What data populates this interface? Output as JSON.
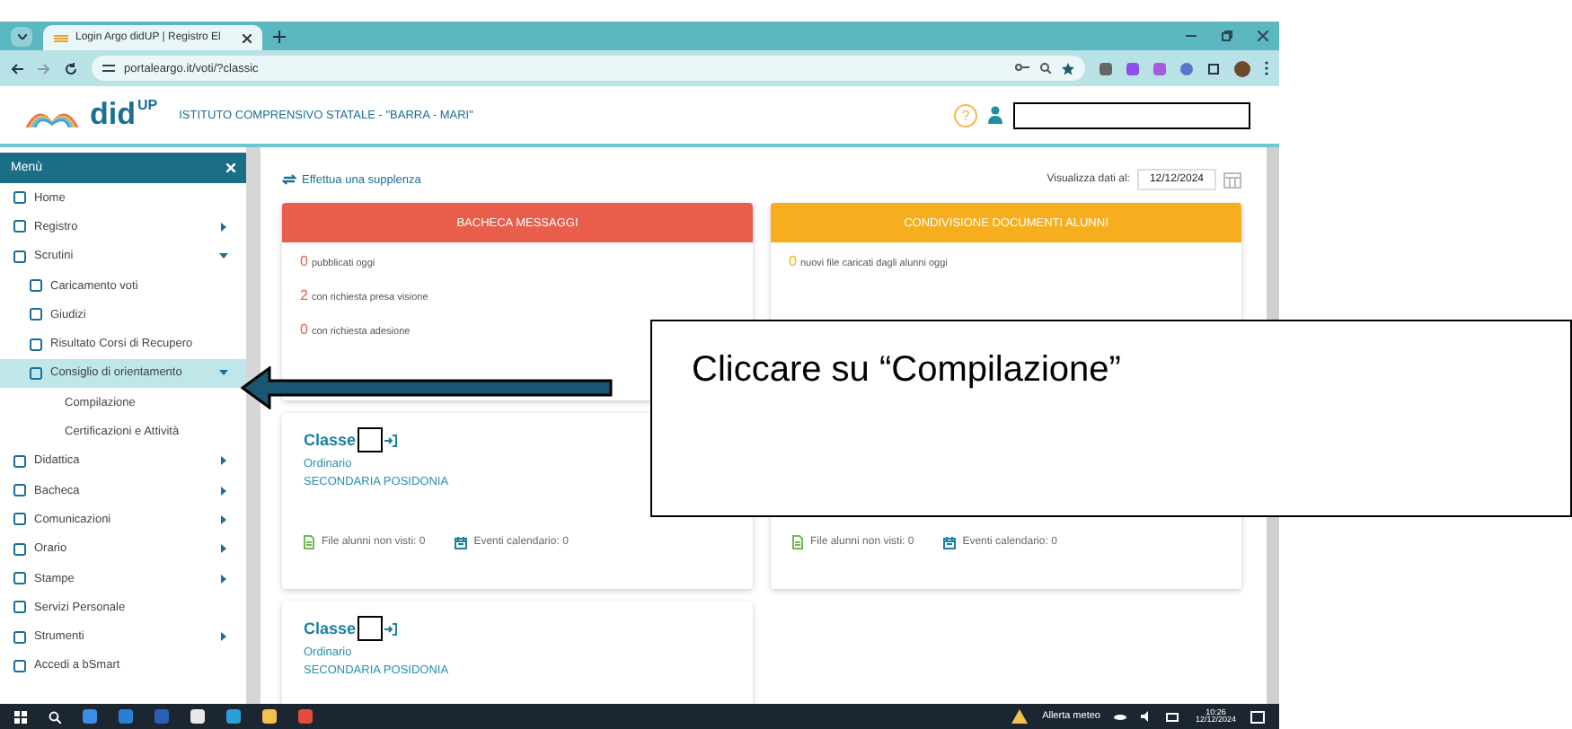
{
  "browser": {
    "tab_title": "Login Argo didUP | Registro El",
    "url": "portaleargo.it/voti/?classic"
  },
  "header": {
    "help": "?",
    "app_name": "did",
    "app_sup": "UP",
    "school": "ISTITUTO COMPRENSIVO STATALE - \"BARRA - MARI\""
  },
  "sidebar": {
    "title": "Menù",
    "items": [
      {
        "label": "Home",
        "selected": false
      },
      {
        "label": "Registro",
        "selected": false,
        "expanded": false
      },
      {
        "label": "Scrutini",
        "selected": false,
        "expanded": true,
        "children": [
          {
            "label": "Caricamento voti",
            "selected": false
          },
          {
            "label": "Giudizi",
            "selected": false
          },
          {
            "label": "Risultato Corsi di Recupero",
            "selected": false
          },
          {
            "label": "Consiglio di orientamento",
            "selected": true,
            "expanded": true,
            "children": [
              {
                "label": "Compilazione",
                "selected": false
              },
              {
                "label": "Certificazioni e Attività",
                "selected": false
              }
            ]
          }
        ]
      },
      {
        "label": "Didattica",
        "selected": false,
        "expanded": false
      },
      {
        "label": "Bacheca",
        "selected": false,
        "expanded": false
      },
      {
        "label": "Comunicazioni",
        "selected": false,
        "expanded": false
      },
      {
        "label": "Orario",
        "selected": false,
        "expanded": false
      },
      {
        "label": "Stampe",
        "selected": false,
        "expanded": false
      },
      {
        "label": "Servizi Personale",
        "selected": false
      },
      {
        "label": "Strumenti",
        "selected": false,
        "expanded": false
      },
      {
        "label": "Accedi a bSmart",
        "selected": false
      }
    ]
  },
  "toolbar": {
    "substitution_link": "Effettua una supplenza",
    "date_label": "Visualizza dati al:",
    "date_value": "12/12/2024"
  },
  "panels": [
    {
      "title": "BACHECA MESSAGGI",
      "color": "#e95d4b",
      "rows": [
        {
          "count": "0",
          "text": "pubblicati oggi"
        },
        {
          "count": "2",
          "text": "con richiesta presa visione"
        },
        {
          "count": "0",
          "text": "con richiesta adesione"
        }
      ]
    },
    {
      "title": "CONDIVISIONE DOCUMENTI ALUNNI",
      "color": "#f7ae1e",
      "rows": [
        {
          "count": "0",
          "text": "nuovi file caricati dagli alunni oggi"
        }
      ]
    }
  ],
  "classes": [
    {
      "title": "Classe",
      "type": "Ordinario",
      "school": "SECONDARIA POSIDONIA",
      "files": "File alunni non visti: 0",
      "events": "Eventi calendario: 0"
    },
    {
      "files": "File alunni non visti: 0",
      "events": "Eventi calendario: 0"
    },
    {
      "title": "Classe",
      "type": "Ordinario",
      "school": "SECONDARIA POSIDONIA"
    }
  ],
  "callout": {
    "text": "Cliccare su “Compilazione”"
  },
  "taskbar": {
    "weather": "Allerta meteo",
    "time": "10:26",
    "date": "12/12/2024"
  }
}
